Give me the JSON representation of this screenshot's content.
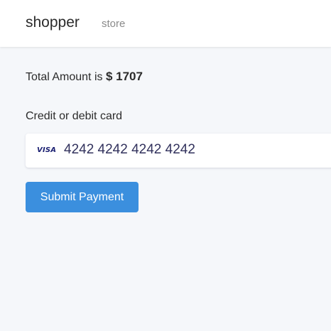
{
  "navbar": {
    "brand": "shopper",
    "links": [
      "store"
    ]
  },
  "checkout": {
    "total_prefix": "Total Amount is",
    "total_amount": "$ 1707",
    "card_label": "Credit or debit card",
    "card_brand_icon": "visa-icon",
    "card_brand_text": "VISA",
    "card_number": "4242 4242 4242 4242",
    "submit_label": "Submit Payment"
  },
  "colors": {
    "accent": "#3b8fde",
    "background": "#f5f7fa",
    "visa": "#1a1f71"
  }
}
